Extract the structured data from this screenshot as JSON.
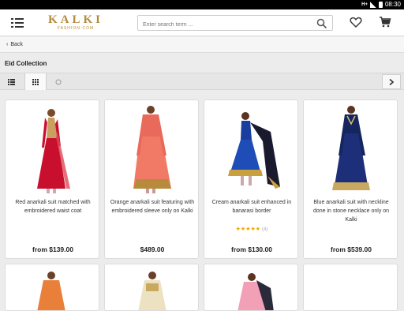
{
  "status_bar": {
    "network": "H+",
    "time": "08:30"
  },
  "header": {
    "logo": {
      "name": "KALKI",
      "tagline": "FASHION·COM"
    },
    "search": {
      "placeholder": "Enter search term ..."
    }
  },
  "nav": {
    "back_label": "Back"
  },
  "page": {
    "title": "Eid Collection"
  },
  "products": [
    {
      "name": "Red anarkali suit matched with embroidered waist coat",
      "price": "from $139.00",
      "rating": null
    },
    {
      "name": "Orange anarkali suit featuring with embroidered sleeve only on Kalki",
      "price": "$489.00",
      "rating": null
    },
    {
      "name": "Cream anarkali suit enhanced in banarasi border",
      "price": "from $130.00",
      "rating": {
        "stars": "★★★★★",
        "count": "(4)"
      }
    },
    {
      "name": "Blue anarkali suit with neckline done in stone necklace only on Kalki",
      "price": "from $539.00",
      "rating": null
    }
  ],
  "colors": {
    "brand": "#b58a3c",
    "star": "#f0a500"
  }
}
